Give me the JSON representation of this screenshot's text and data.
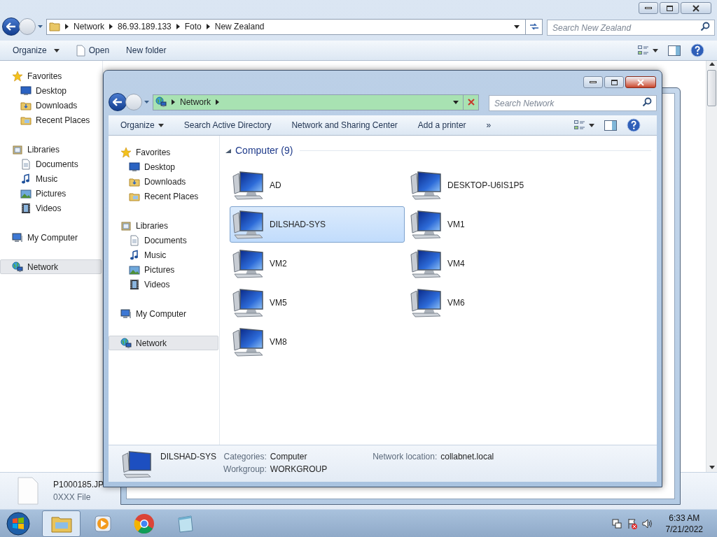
{
  "back_window": {
    "address": [
      "Network",
      "86.93.189.133",
      "Foto",
      "New Zealand"
    ],
    "search_placeholder": "Search New Zealand",
    "toolbar": [
      "Organize",
      "Open",
      "New folder"
    ],
    "nav": [
      {
        "label": "Favorites",
        "selected": false,
        "children": [
          {
            "label": "Desktop",
            "selected": false
          },
          {
            "label": "Downloads",
            "selected": false
          },
          {
            "label": "Recent Places",
            "selected": false
          }
        ]
      },
      {
        "label": "Libraries",
        "selected": false,
        "children": [
          {
            "label": "Documents",
            "selected": false
          },
          {
            "label": "Music",
            "selected": false
          },
          {
            "label": "Pictures",
            "selected": false
          },
          {
            "label": "Videos",
            "selected": false
          }
        ]
      },
      {
        "label": "My Computer",
        "selected": false
      },
      {
        "label": "Network",
        "selected": true
      }
    ],
    "details": {
      "name": "P1000185.JP",
      "type": "0XXX File"
    }
  },
  "front_window": {
    "address": {
      "crumbs": [
        "Network"
      ],
      "level": 1
    },
    "search_placeholder": "Search Network",
    "toolbar": [
      "Organize",
      "Search Active Directory",
      "Network and Sharing Center",
      "Add a printer",
      "»"
    ],
    "nav": [
      {
        "label": "Favorites",
        "selected": false,
        "children": [
          {
            "label": "Desktop",
            "selected": false
          },
          {
            "label": "Downloads",
            "selected": false
          },
          {
            "label": "Recent Places",
            "selected": false
          }
        ]
      },
      {
        "label": "Libraries",
        "selected": false,
        "children": [
          {
            "label": "Documents",
            "selected": false
          },
          {
            "label": "Music",
            "selected": false
          },
          {
            "label": "Pictures",
            "selected": false
          },
          {
            "label": "Videos",
            "selected": false
          }
        ]
      },
      {
        "label": "My Computer",
        "selected": false
      },
      {
        "label": "Network",
        "selected": true
      }
    ],
    "group": "Computer (9)",
    "computers": [
      {
        "name": "AD",
        "selected": false
      },
      {
        "name": "DESKTOP-U6IS1P5",
        "selected": false
      },
      {
        "name": "DILSHAD-SYS",
        "selected": true
      },
      {
        "name": "VM1",
        "selected": false
      },
      {
        "name": "VM2",
        "selected": false
      },
      {
        "name": "VM4",
        "selected": false
      },
      {
        "name": "VM5",
        "selected": false
      },
      {
        "name": "VM6",
        "selected": false
      },
      {
        "name": "VM8",
        "selected": false
      }
    ],
    "details": {
      "name": "DILSHAD-SYS",
      "fields": [
        {
          "label": "Categories:",
          "value": "Computer"
        },
        {
          "label": "Network location:",
          "value": "collabnet.local"
        },
        {
          "label": "Workgroup:",
          "value": "WORKGROUP"
        }
      ]
    }
  },
  "taskbar": {
    "buttons": [
      {
        "selected": true
      },
      {
        "selected": false
      },
      {
        "selected": false
      },
      {
        "selected": false
      }
    ],
    "time": "6:33 AM",
    "date": "7/21/2022"
  }
}
